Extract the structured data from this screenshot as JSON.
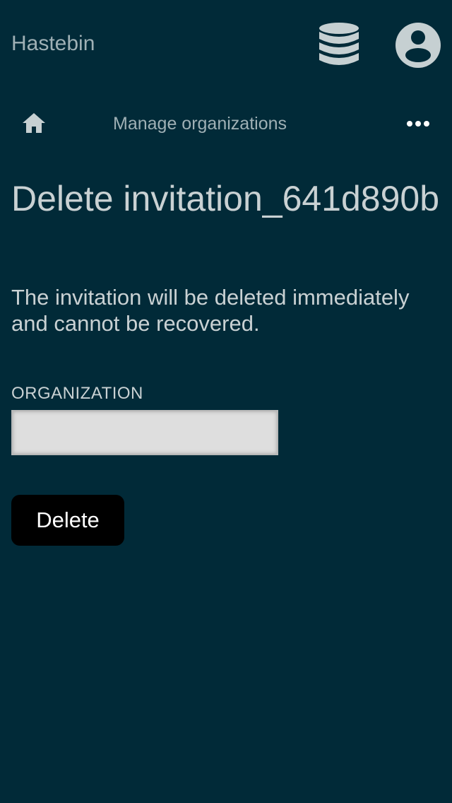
{
  "header": {
    "app_title": "Hastebin",
    "icons": {
      "database": "database-icon",
      "account": "account-circle-icon"
    }
  },
  "nav": {
    "home_icon": "home-icon",
    "breadcrumb": "Manage organizations",
    "more_icon": "more-horizontal-icon"
  },
  "main": {
    "title": "Delete invitation_641d890b",
    "description": "The invitation will be deleted immediately and cannot be recovered.",
    "organization": {
      "label": "ORGANIZATION",
      "value": "",
      "placeholder": ""
    },
    "delete_label": "Delete"
  },
  "colors": {
    "background": "#012a38",
    "text": "#c9d1d3",
    "muted_text": "#9fb0b5",
    "icon": "#c6d0d2",
    "button_bg": "#000000",
    "button_text": "#ffffff",
    "input_bg": "#dedede"
  }
}
